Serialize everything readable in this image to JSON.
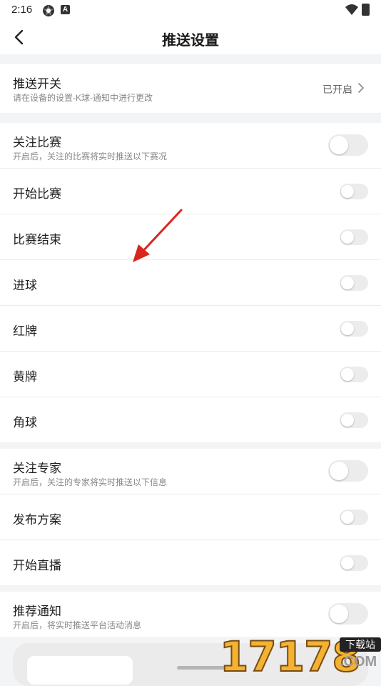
{
  "status_bar": {
    "time": "2:16",
    "icons": [
      "settings-gear-icon",
      "a-badge-icon",
      "wifi-icon",
      "battery-icon"
    ],
    "badge_letter": "A"
  },
  "header": {
    "title": "推送设置",
    "back_icon": "back-chevron-icon"
  },
  "push_switch": {
    "label": "推送开关",
    "desc": "请在设备的设置-K球-通知中进行更改",
    "value": "已开启"
  },
  "match_section": {
    "master": {
      "label": "关注比赛",
      "desc": "开启后，关注的比赛将实时推送以下赛况",
      "on": false
    },
    "items": [
      {
        "label": "开始比赛",
        "on": false
      },
      {
        "label": "比赛结束",
        "on": false
      },
      {
        "label": "进球",
        "on": false
      },
      {
        "label": "红牌",
        "on": false
      },
      {
        "label": "黄牌",
        "on": false
      },
      {
        "label": "角球",
        "on": false
      }
    ]
  },
  "expert_section": {
    "master": {
      "label": "关注专家",
      "desc": "开启后，关注的专家将实时推送以下信息",
      "on": false
    },
    "items": [
      {
        "label": "发布方案",
        "on": false
      },
      {
        "label": "开始直播",
        "on": false
      }
    ]
  },
  "recommend_section": {
    "master": {
      "label": "推荐通知",
      "desc": "开启后，将实时推送平台活动消息",
      "on": false
    }
  },
  "watermark": {
    "digits": "17178",
    "tag": "下载站",
    "domain": ".COM"
  },
  "colors": {
    "background": "#f3f4f6",
    "toggle_off": "#ececec",
    "annotation_arrow": "#d9261c",
    "watermark": "#f3b232"
  }
}
